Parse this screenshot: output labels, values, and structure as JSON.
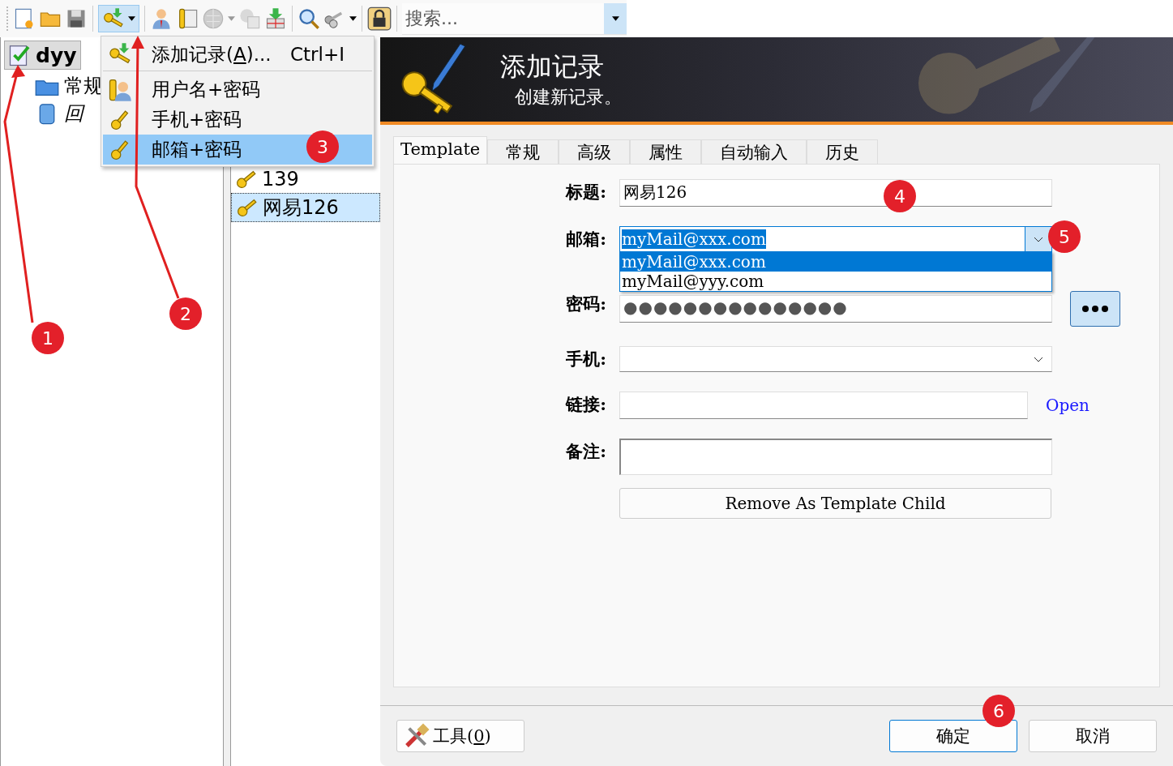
{
  "toolbar": {
    "search_placeholder": "搜索..."
  },
  "add_menu": [
    {
      "kind": "add",
      "label": "添加记录(",
      "mnemonic": "A",
      "label_end": ")...",
      "shortcut": "Ctrl+I",
      "selected": false
    },
    {
      "kind": "user",
      "label": "用户名+密码",
      "selected": false
    },
    {
      "kind": "key",
      "label": "手机+密码",
      "selected": false
    },
    {
      "kind": "key",
      "label": "邮箱+密码",
      "selected": true
    }
  ],
  "tree": [
    {
      "label": "dyy",
      "kind": "database",
      "selected": true,
      "children": [
        {
          "label": "常规",
          "kind": "folder",
          "selected": false
        },
        {
          "label": "回",
          "kind": "recycle",
          "selected": false
        }
      ]
    }
  ],
  "entries": [
    {
      "label": "139",
      "selected": false
    },
    {
      "label": "网易126",
      "selected": true
    }
  ],
  "dialog": {
    "title": "添加记录",
    "subtitle": "创建新记录。",
    "tabs": [
      {
        "label": "Template",
        "selected": true
      },
      {
        "label": "常规",
        "selected": false
      },
      {
        "label": "高级",
        "selected": false
      },
      {
        "label": "属性",
        "selected": false
      },
      {
        "label": "自动输入",
        "selected": false
      },
      {
        "label": "历史",
        "selected": false
      }
    ],
    "fields": [
      {
        "kind": "text",
        "label": "标题:",
        "value": "网易126"
      },
      {
        "kind": "combo",
        "label": "邮箱:",
        "value": "myMail@xxx.com",
        "open": true,
        "options": [
          {
            "label": "myMail@xxx.com",
            "selected": true
          },
          {
            "label": "myMail@yyy.com",
            "selected": false
          }
        ]
      },
      {
        "kind": "password",
        "label": "密码:",
        "value": "●●●●●●●●●●●●●●●"
      },
      {
        "kind": "combo",
        "label": "手机:",
        "open": false
      },
      {
        "kind": "url",
        "label": "链接:",
        "link": "Open"
      },
      {
        "kind": "notes",
        "label": "备注:"
      }
    ],
    "template_button": "Remove As Template Child",
    "tools_button": {
      "label": "工具(",
      "mnemonic": "0",
      "label_end": ")"
    },
    "ok_button": "确定",
    "cancel_button": "取消"
  },
  "annotations": [
    "1",
    "2",
    "3",
    "4",
    "5",
    "6"
  ]
}
